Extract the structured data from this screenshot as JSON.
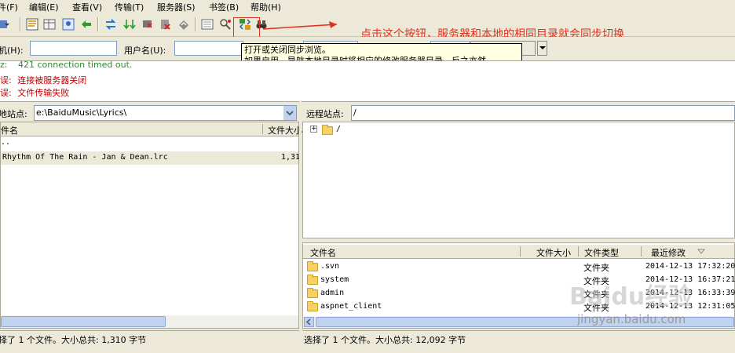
{
  "menu": [
    {
      "label": "件(F)"
    },
    {
      "label": "编辑(E)"
    },
    {
      "label": "查看(V)"
    },
    {
      "label": "传输(T)"
    },
    {
      "label": "服务器(S)"
    },
    {
      "label": "书签(B)"
    },
    {
      "label": "帮助(H)"
    }
  ],
  "quickconnect": {
    "host_label": "机(H):",
    "user_label": "用户名(U):",
    "host_value": "",
    "user_value": ""
  },
  "log": [
    {
      "prefix": "z:",
      "text": "421 connection timed out.",
      "color": "#2e8b2e"
    },
    {
      "prefix": "误:",
      "text": "连接被服务器关闭",
      "color": "#c00000"
    },
    {
      "prefix": "误:",
      "text": "文件传输失败",
      "color": "#c00000"
    }
  ],
  "local": {
    "site_label": "地站点:",
    "path": "e:\\BaiduMusic\\Lyrics\\",
    "col_name": "件名",
    "col_size": "文件大小",
    "rows": [
      {
        "name": "..",
        "size": ""
      },
      {
        "name": "Rhythm Of The Rain - Jan & Dean.lrc",
        "size": "1,31"
      }
    ],
    "status": "择了 1 个文件。大小总共: 1,310 字节"
  },
  "remote": {
    "site_label": "远程站点:",
    "path": "/",
    "tree_root": "/",
    "col_name": "文件名",
    "col_size": "文件大小",
    "col_type": "文件类型",
    "col_modified": "最近修改",
    "rows": [
      {
        "name": ".svn",
        "type": "文件夹",
        "modified": "2014-12-13 17:32:20"
      },
      {
        "name": "system",
        "type": "文件夹",
        "modified": "2014-12-13 16:37:21"
      },
      {
        "name": "admin",
        "type": "文件夹",
        "modified": "2014-12-13 16:33:39"
      },
      {
        "name": "aspnet_client",
        "type": "文件夹",
        "modified": "2014-12-13 12:31:05"
      }
    ],
    "status": "选择了 1 个文件。大小总共: 12,092 字节"
  },
  "tooltip": {
    "line1": "打开或关闭同步浏览。",
    "line2": "如果启用，导航本地目录时将相应的修改服务器目录，反之亦然。"
  },
  "annotation": "点击这个按钮，服务器和本地的相同目录就会同步切换",
  "watermark": {
    "brand": "Baidu经验",
    "url": "jingyan.baidu.com"
  },
  "colors": {
    "annotation_red": "#e0301e",
    "tooltip_bg": "#ffffe1",
    "selection": "#ece9d8"
  }
}
